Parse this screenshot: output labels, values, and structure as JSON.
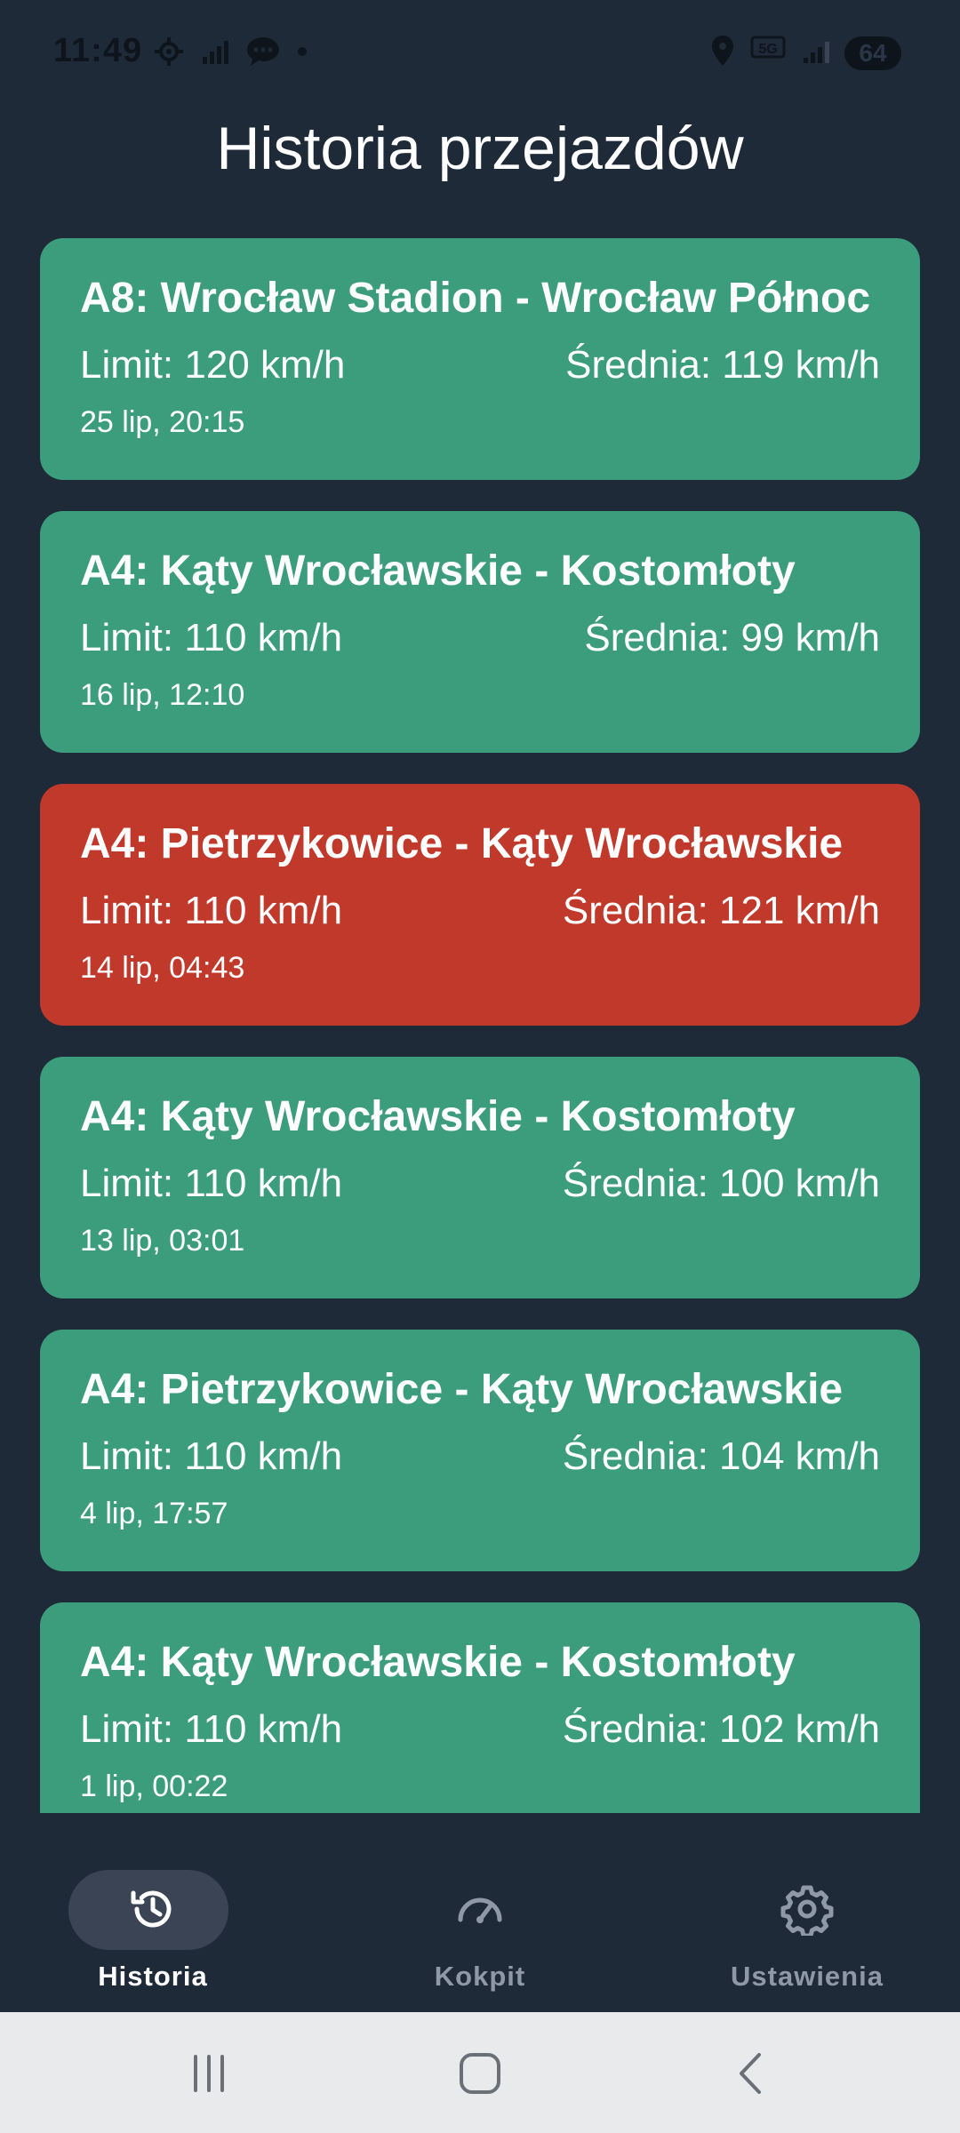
{
  "status_bar": {
    "time": "11:49",
    "battery": "64",
    "left_icons": [
      "location-target-icon",
      "no-signal-icon",
      "message-bubble-icon",
      "dot-icon"
    ],
    "right_icons": [
      "location-pin-icon",
      "5g-icon",
      "signal-icon",
      "battery-icon"
    ]
  },
  "header": {
    "title": "Historia przejazdów"
  },
  "trips": [
    {
      "title": "A8: Wrocław Stadion - Wrocław Północ",
      "limit": "Limit: 120 km/h",
      "average": "Średnia: 119 km/h",
      "date": "25 lip, 20:15",
      "status": "ok"
    },
    {
      "title": "A4: Kąty Wrocławskie - Kostomłoty",
      "limit": "Limit: 110 km/h",
      "average": "Średnia: 99 km/h",
      "date": "16 lip, 12:10",
      "status": "ok"
    },
    {
      "title": "A4: Pietrzykowice - Kąty Wrocławskie",
      "limit": "Limit: 110 km/h",
      "average": "Średnia: 121 km/h",
      "date": "14 lip, 04:43",
      "status": "exceeded"
    },
    {
      "title": "A4: Kąty Wrocławskie - Kostomłoty",
      "limit": "Limit: 110 km/h",
      "average": "Średnia: 100 km/h",
      "date": "13 lip, 03:01",
      "status": "ok"
    },
    {
      "title": "A4: Pietrzykowice - Kąty Wrocławskie",
      "limit": "Limit: 110 km/h",
      "average": "Średnia: 104 km/h",
      "date": "4 lip, 17:57",
      "status": "ok"
    },
    {
      "title": "A4: Kąty Wrocławskie - Kostomłoty",
      "limit": "Limit: 110 km/h",
      "average": "Średnia: 102 km/h",
      "date": "1 lip, 00:22",
      "status": "ok"
    }
  ],
  "bottom_nav": {
    "items": [
      {
        "label": "Historia",
        "icon": "history-icon",
        "active": true
      },
      {
        "label": "Kokpit",
        "icon": "speedometer-icon",
        "active": false
      },
      {
        "label": "Ustawienia",
        "icon": "gear-icon",
        "active": false
      }
    ]
  },
  "system_nav": {
    "buttons": [
      "recents-icon",
      "home-icon",
      "back-icon"
    ]
  },
  "colors": {
    "background": "#1f2a39",
    "card_ok": "#3c9d7c",
    "card_exceeded": "#c0392b",
    "nav_active_pill": "#3a4454",
    "nav_inactive": "#8f98a6",
    "nav_active": "#ffffff"
  }
}
